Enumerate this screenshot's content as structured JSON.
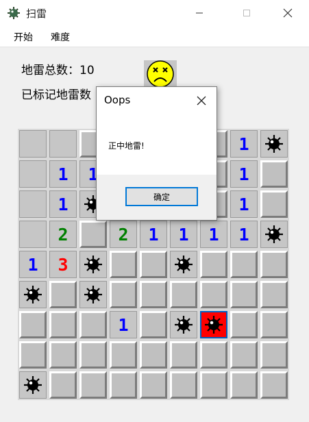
{
  "window": {
    "title": "扫雷"
  },
  "menu": {
    "start": "开始",
    "difficulty": "难度"
  },
  "info": {
    "total_label": "地雷总数：10",
    "flagged_label": "已标记地雷数"
  },
  "face": {
    "state": "dead",
    "icon": "dead-face-icon"
  },
  "dialog": {
    "title": "Oops",
    "message": "正中地雷!",
    "ok_label": "确定"
  },
  "colors": {
    "one": "#0000ff",
    "two": "#008000",
    "three": "#ff0000",
    "exploded": "#ff0000",
    "cell": "#c0c0c0"
  },
  "board": {
    "rows": 9,
    "cols": 9,
    "legend": {
      "C": "covered",
      "O": "opened-empty",
      "M": "mine",
      "X": "exploded-mine",
      "1-8": "number"
    },
    "cells": [
      [
        "O",
        "O",
        "C",
        "C",
        "C",
        "C",
        "C",
        "1",
        "M"
      ],
      [
        "O",
        "1",
        "1",
        "C",
        "C",
        "C",
        "C",
        "1",
        "C"
      ],
      [
        "O",
        "1",
        "M",
        "C",
        "C",
        "C",
        "C",
        "1",
        "C"
      ],
      [
        "O",
        "2",
        "C",
        "2",
        "1",
        "1",
        "1",
        "1",
        "M"
      ],
      [
        "1",
        "3",
        "M",
        "C",
        "C",
        "M",
        "C",
        "C",
        "C"
      ],
      [
        "M",
        "C",
        "M",
        "C",
        "C",
        "C",
        "C",
        "C",
        "C"
      ],
      [
        "C",
        "C",
        "C",
        "1",
        "C",
        "M",
        "X",
        "C",
        "C"
      ],
      [
        "C",
        "C",
        "C",
        "C",
        "C",
        "C",
        "C",
        "C",
        "C"
      ],
      [
        "M",
        "C",
        "C",
        "C",
        "C",
        "C",
        "C",
        "C",
        "C"
      ]
    ]
  }
}
